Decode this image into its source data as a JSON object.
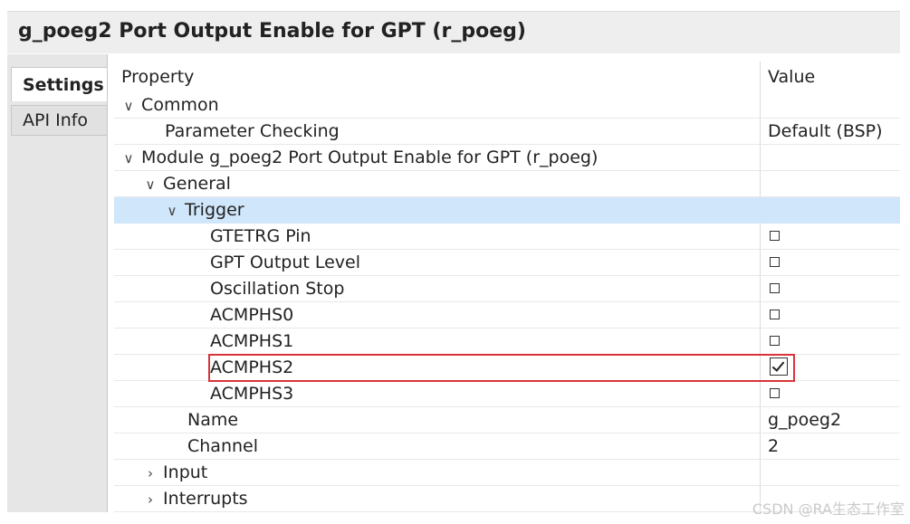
{
  "title": "g_poeg2 Port Output Enable for GPT (r_poeg)",
  "side_tabs": [
    "Settings",
    "API Info"
  ],
  "columns": {
    "property": "Property",
    "value": "Value"
  },
  "rows": [
    {
      "label": "Common",
      "value": "",
      "chevron": "down",
      "indent": 0,
      "kind": "text"
    },
    {
      "label": "Parameter Checking",
      "value": "Default (BSP)",
      "chevron": "",
      "indent": 1,
      "kind": "text"
    },
    {
      "label": "Module g_poeg2 Port Output Enable for GPT (r_poeg)",
      "value": "",
      "chevron": "down",
      "indent": 0,
      "kind": "text"
    },
    {
      "label": "General",
      "value": "",
      "chevron": "down",
      "indent": 1,
      "kind": "text"
    },
    {
      "label": "Trigger",
      "value": "",
      "chevron": "down",
      "indent": 2,
      "kind": "text",
      "selected": true
    },
    {
      "label": "GTETRG Pin",
      "value": "",
      "chevron": "",
      "indent": 3,
      "kind": "checkbox",
      "checked": false
    },
    {
      "label": "GPT Output Level",
      "value": "",
      "chevron": "",
      "indent": 3,
      "kind": "checkbox",
      "checked": false
    },
    {
      "label": "Oscillation Stop",
      "value": "",
      "chevron": "",
      "indent": 3,
      "kind": "checkbox",
      "checked": false
    },
    {
      "label": "ACMPHS0",
      "value": "",
      "chevron": "",
      "indent": 3,
      "kind": "checkbox",
      "checked": false
    },
    {
      "label": "ACMPHS1",
      "value": "",
      "chevron": "",
      "indent": 3,
      "kind": "checkbox",
      "checked": false
    },
    {
      "label": "ACMPHS2",
      "value": "",
      "chevron": "",
      "indent": 3,
      "kind": "checkbox",
      "checked": true
    },
    {
      "label": "ACMPHS3",
      "value": "",
      "chevron": "",
      "indent": 3,
      "kind": "checkbox",
      "checked": false
    },
    {
      "label": "Name",
      "value": "g_poeg2",
      "chevron": "",
      "indent": 2,
      "kind": "text"
    },
    {
      "label": "Channel",
      "value": "2",
      "chevron": "",
      "indent": 2,
      "kind": "text"
    },
    {
      "label": "Input",
      "value": "",
      "chevron": "right",
      "indent": 1,
      "kind": "text"
    },
    {
      "label": "Interrupts",
      "value": "",
      "chevron": "right",
      "indent": 1,
      "kind": "text"
    }
  ],
  "colors": {
    "selection": "#cfe6fb",
    "highlight_box": "#d9343a"
  },
  "watermark": "CSDN @RA生态工作室"
}
